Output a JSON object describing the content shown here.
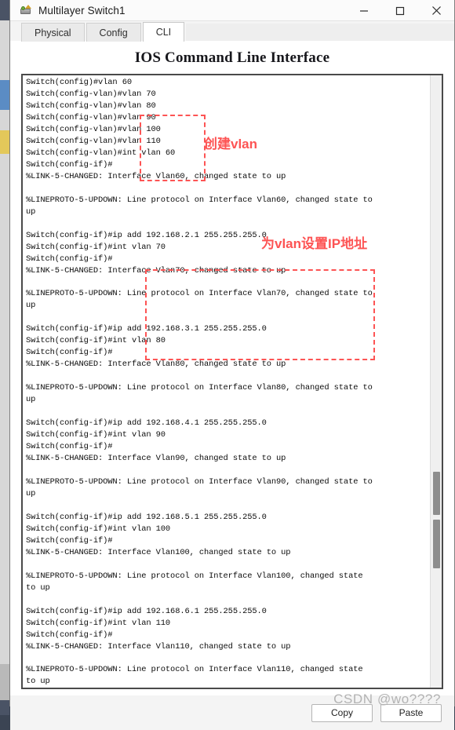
{
  "window": {
    "title": "Multilayer Switch1",
    "icon": "switch-device-icon",
    "controls": {
      "minimize": "minimize-icon",
      "maximize": "maximize-icon",
      "close": "close-icon"
    }
  },
  "tabs": [
    {
      "label": "Physical",
      "active": false
    },
    {
      "label": "Config",
      "active": false
    },
    {
      "label": "CLI",
      "active": true
    }
  ],
  "panel": {
    "heading": "IOS Command Line Interface"
  },
  "terminal": {
    "lines": [
      "Switch(config)#vlan 60",
      "Switch(config-vlan)#vlan 70",
      "Switch(config-vlan)#vlan 80",
      "Switch(config-vlan)#vlan 90",
      "Switch(config-vlan)#vlan 100",
      "Switch(config-vlan)#vlan 110",
      "Switch(config-vlan)#int vlan 60",
      "Switch(config-if)#",
      "%LINK-5-CHANGED: Interface Vlan60, changed state to up",
      "",
      "%LINEPROTO-5-UPDOWN: Line protocol on Interface Vlan60, changed state to",
      "up",
      "",
      "Switch(config-if)#ip add 192.168.2.1 255.255.255.0",
      "Switch(config-if)#int vlan 70",
      "Switch(config-if)#",
      "%LINK-5-CHANGED: Interface Vlan70, changed state to up",
      "",
      "%LINEPROTO-5-UPDOWN: Line protocol on Interface Vlan70, changed state to",
      "up",
      "",
      "Switch(config-if)#ip add 192.168.3.1 255.255.255.0",
      "Switch(config-if)#int vlan 80",
      "Switch(config-if)#",
      "%LINK-5-CHANGED: Interface Vlan80, changed state to up",
      "",
      "%LINEPROTO-5-UPDOWN: Line protocol on Interface Vlan80, changed state to",
      "up",
      "",
      "Switch(config-if)#ip add 192.168.4.1 255.255.255.0",
      "Switch(config-if)#int vlan 90",
      "Switch(config-if)#",
      "%LINK-5-CHANGED: Interface Vlan90, changed state to up",
      "",
      "%LINEPROTO-5-UPDOWN: Line protocol on Interface Vlan90, changed state to",
      "up",
      "",
      "Switch(config-if)#ip add 192.168.5.1 255.255.255.0",
      "Switch(config-if)#int vlan 100",
      "Switch(config-if)#",
      "%LINK-5-CHANGED: Interface Vlan100, changed state to up",
      "",
      "%LINEPROTO-5-UPDOWN: Line protocol on Interface Vlan100, changed state",
      "to up",
      "",
      "Switch(config-if)#ip add 192.168.6.1 255.255.255.0",
      "Switch(config-if)#int vlan 110",
      "Switch(config-if)#",
      "%LINK-5-CHANGED: Interface Vlan110, changed state to up",
      "",
      "%LINEPROTO-5-UPDOWN: Line protocol on Interface Vlan110, changed state",
      "to up"
    ]
  },
  "annotations": [
    {
      "text": "创建vlan",
      "color": "#fd5454",
      "target": "vlan-creation-commands"
    },
    {
      "text": "为vlan设置IP地址",
      "color": "#fd5454",
      "target": "vlan-ip-assignment-commands"
    }
  ],
  "buttons": {
    "copy": "Copy",
    "paste": "Paste"
  },
  "watermark": "CSDN @wo????",
  "colors": {
    "annotation_red": "#fd5454",
    "titlebar": "#fbfbfb",
    "active_tab": "#ffffff",
    "terminal_bg": "#ffffff",
    "terminal_text": "#0c0c0c"
  }
}
